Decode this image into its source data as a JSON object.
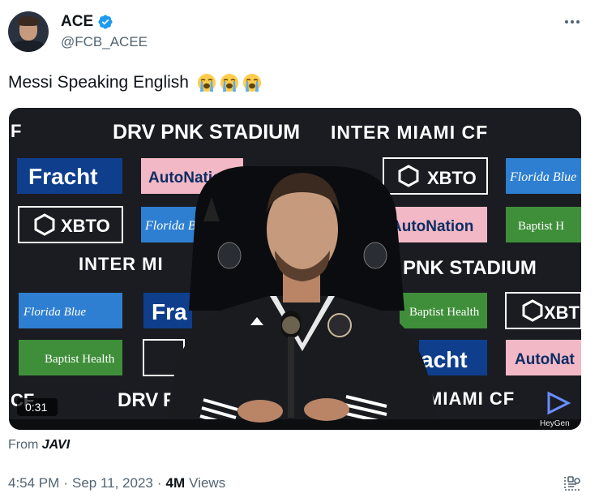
{
  "author": {
    "display_name": "ACE",
    "handle": "@FCB_ACEE"
  },
  "tweet": {
    "text": "Messi Speaking English",
    "emojis": [
      "loudly-crying-face",
      "loudly-crying-face",
      "loudly-crying-face"
    ]
  },
  "media": {
    "duration": "0:31",
    "watermark": "HeyGen",
    "backdrop_texts": {
      "stadium": "DRV PNK STADIUM",
      "club": "INTER MIAMI CF",
      "fracht": "Fracht",
      "autonation": "AutoNation",
      "xbto": "XBTO",
      "florida_blue": "Florida Blue",
      "baptist": "Baptist Health"
    }
  },
  "source": {
    "prefix": "From",
    "name": "JAVI"
  },
  "meta": {
    "time": "4:54 PM",
    "date": "Sep 11, 2023",
    "views_count": "4M",
    "views_label": "Views"
  },
  "colors": {
    "verified_blue": "#1d9bf0",
    "secondary_text": "#536471",
    "fracht_blue": "#0f3f8c",
    "autonation_pink": "#f2b8c6",
    "florida_blue": "#2e7fd1",
    "baptist_green": "#3f8f3a"
  }
}
